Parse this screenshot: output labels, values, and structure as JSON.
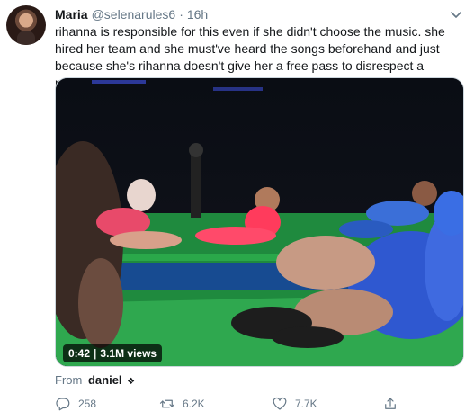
{
  "tweet": {
    "author_name": "Maria",
    "author_handle": "@selenarules6",
    "separator": "·",
    "time": "16h",
    "text": "rihanna is responsible for this even if she didn't choose the music. she hired her team and she must've heard the songs beforehand and just because she's rihanna doesn't give her a free pass to disrespect a religion",
    "avatar_icon": "avatar-photo",
    "menu_icon": "chevron-down-icon"
  },
  "video": {
    "duration": "0:42",
    "views": "3.1M views",
    "sep": "|"
  },
  "source": {
    "prefix": "From",
    "account": "daniel",
    "badge": "❖"
  },
  "actions": {
    "reply_count": "258",
    "retweet_count": "6.2K",
    "like_count": "7.7K",
    "reply_icon": "reply-icon",
    "retweet_icon": "retweet-icon",
    "like_icon": "heart-icon",
    "share_icon": "share-icon"
  },
  "colors": {
    "text_primary": "#14171a",
    "text_secondary": "#657786",
    "border": "#ccd6dd"
  }
}
